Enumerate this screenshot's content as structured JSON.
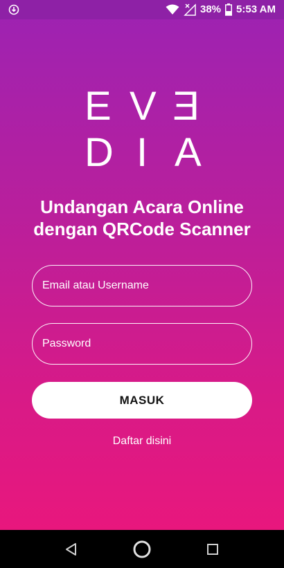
{
  "status_bar": {
    "left_icon": "download-notification-icon",
    "wifi_icon": "wifi-icon",
    "signal_icon": "no-signal-icon",
    "battery_percent": "38%",
    "battery_icon": "battery-icon",
    "time": "5:53 AM"
  },
  "logo": {
    "row1": [
      "E",
      "V",
      "E"
    ],
    "row2": [
      "D",
      "I",
      "A"
    ]
  },
  "headline": {
    "line1": "Undangan Acara Online",
    "line2": "dengan QRCode Scanner"
  },
  "form": {
    "email_placeholder": "Email atau Username",
    "password_placeholder": "Password",
    "submit_label": "MASUK",
    "register_link": "Daftar disini"
  },
  "nav": {
    "back_icon": "back-triangle-icon",
    "home_icon": "home-circle-icon",
    "recents_icon": "recents-square-icon"
  },
  "colors": {
    "gradient_top": "#9c23b3",
    "gradient_bottom": "#e8177d",
    "button_bg": "#ffffff"
  }
}
